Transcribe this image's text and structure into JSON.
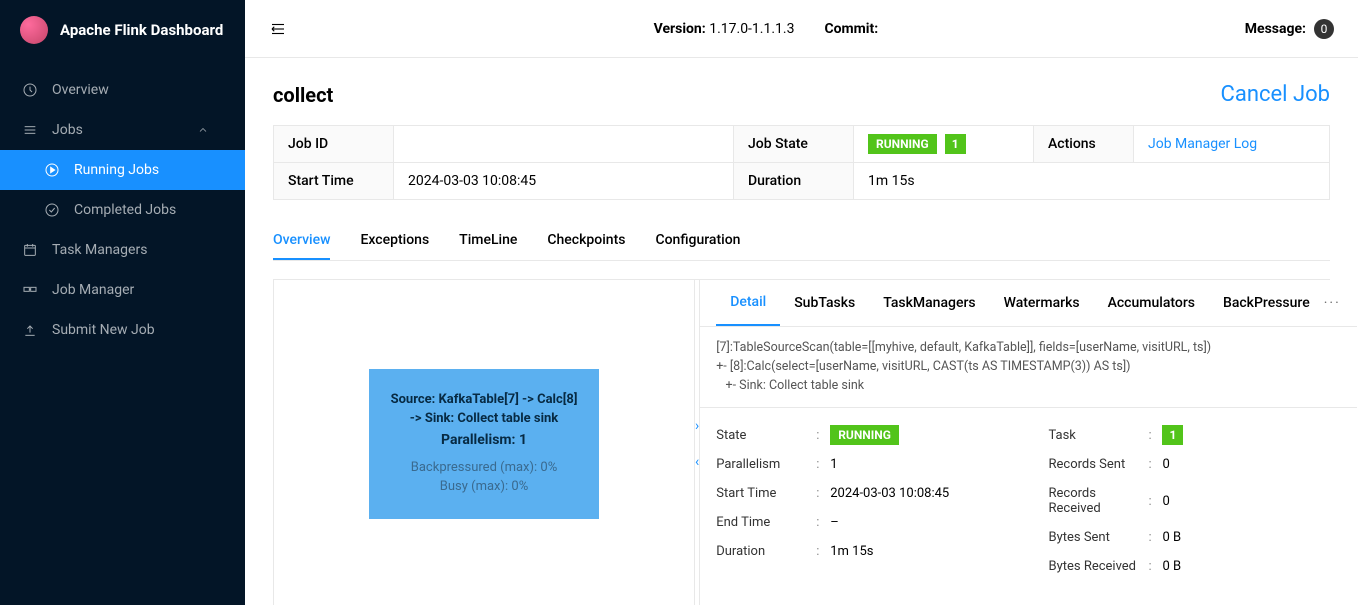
{
  "app_title": "Apache Flink Dashboard",
  "topbar": {
    "version_label": "Version:",
    "version_value": "1.17.0-1.1.1.3",
    "commit_label": "Commit:",
    "commit_value": "",
    "message_label": "Message:",
    "message_count": "0"
  },
  "nav": {
    "overview": "Overview",
    "jobs": "Jobs",
    "running_jobs": "Running Jobs",
    "completed_jobs": "Completed Jobs",
    "task_managers": "Task Managers",
    "job_manager": "Job Manager",
    "submit_new_job": "Submit New Job"
  },
  "page": {
    "title": "collect",
    "cancel_label": "Cancel Job"
  },
  "job_table": {
    "job_id_label": "Job ID",
    "job_id_value": "",
    "job_state_label": "Job State",
    "job_state_value": "RUNNING",
    "job_state_count": "1",
    "actions_label": "Actions",
    "actions_link": "Job Manager Log",
    "start_time_label": "Start Time",
    "start_time_value": "2024-03-03 10:08:45",
    "duration_label": "Duration",
    "duration_value": "1m 15s"
  },
  "tabs": {
    "overview": "Overview",
    "exceptions": "Exceptions",
    "timeline": "TimeLine",
    "checkpoints": "Checkpoints",
    "configuration": "Configuration"
  },
  "graph_node": {
    "title": "Source: KafkaTable[7] -> Calc[8] -> Sink: Collect table sink",
    "parallelism": "Parallelism: 1",
    "backpressured": "Backpressured (max): 0%",
    "busy": "Busy (max): 0%"
  },
  "detail_tabs": {
    "detail": "Detail",
    "subtasks": "SubTasks",
    "taskmanagers": "TaskManagers",
    "watermarks": "Watermarks",
    "accumulators": "Accumulators",
    "backpressure": "BackPressure"
  },
  "plan_text": {
    "line1": "[7]:TableSourceScan(table=[[myhive, default, KafkaTable]], fields=[userName, visitURL, ts])",
    "line2": "+- [8]:Calc(select=[userName, visitURL, CAST(ts AS TIMESTAMP(3)) AS ts])",
    "line3": "   +- Sink: Collect table sink"
  },
  "stats": {
    "left": {
      "state_label": "State",
      "state_value": "RUNNING",
      "parallelism_label": "Parallelism",
      "parallelism_value": "1",
      "start_time_label": "Start Time",
      "start_time_value": "2024-03-03 10:08:45",
      "end_time_label": "End Time",
      "end_time_value": "–",
      "duration_label": "Duration",
      "duration_value": "1m 15s"
    },
    "right": {
      "task_label": "Task",
      "task_value": "1",
      "records_sent_label": "Records Sent",
      "records_sent_value": "0",
      "records_received_label": "Records Received",
      "records_received_value": "0",
      "bytes_sent_label": "Bytes Sent",
      "bytes_sent_value": "0 B",
      "bytes_received_label": "Bytes Received",
      "bytes_received_value": "0 B"
    }
  }
}
